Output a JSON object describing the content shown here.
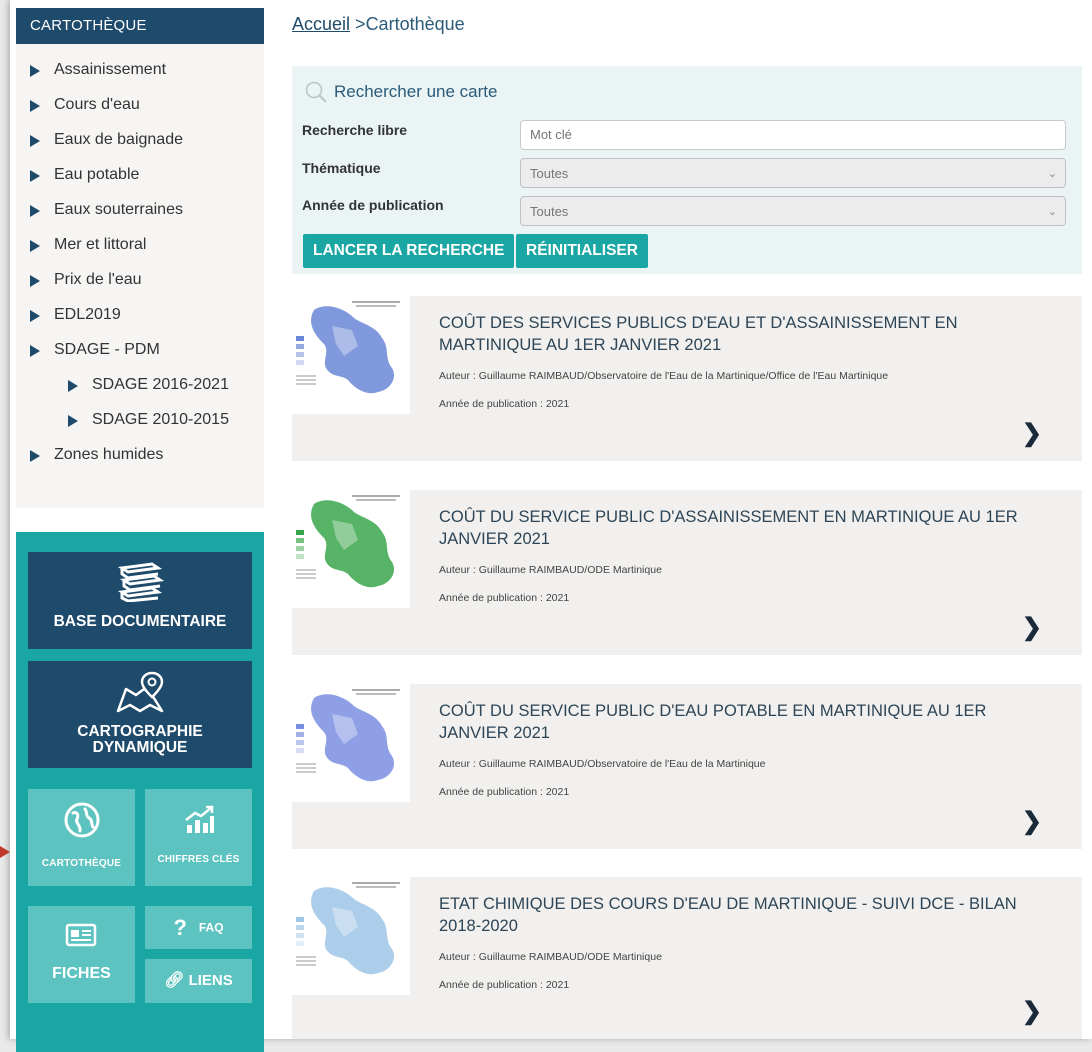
{
  "sidebar": {
    "title": "CARTOTHÈQUE",
    "items": [
      {
        "label": "Assainissement"
      },
      {
        "label": "Cours d'eau"
      },
      {
        "label": "Eaux de baignade"
      },
      {
        "label": "Eau potable"
      },
      {
        "label": "Eaux souterraines"
      },
      {
        "label": "Mer et littoral"
      },
      {
        "label": "Prix de l'eau"
      },
      {
        "label": "EDL2019"
      },
      {
        "label": "SDAGE - PDM"
      },
      {
        "label": "SDAGE 2016-2021"
      },
      {
        "label": "SDAGE 2010-2015"
      },
      {
        "label": "Zones humides"
      }
    ],
    "tiles": {
      "base_documentaire": "BASE DOCUMENTAIRE",
      "cartographie_line1": "CARTOGRAPHIE",
      "cartographie_line2": "DYNAMIQUE",
      "cartotheque": "CARTOTHÈQUE",
      "chiffres_cles": "CHIFFRES CLÉS",
      "fiches": "FICHES",
      "faq": "FAQ",
      "liens": "LIENS"
    }
  },
  "breadcrumb": {
    "home": "Accueil",
    "separator": ">",
    "current": "Cartothèque"
  },
  "search": {
    "title": "Rechercher une carte",
    "free_label": "Recherche libre",
    "free_placeholder": "Mot clé",
    "theme_label": "Thématique",
    "theme_value": "Toutes",
    "year_label": "Année de publication",
    "year_value": "Toutes",
    "submit_label": "LANCER LA RECHERCHE",
    "reset_label": "RÉINITIALISER"
  },
  "results": [
    {
      "title": "COÛT DES SERVICES PUBLICS D'EAU ET D'ASSAINISSEMENT EN MARTINIQUE AU 1ER JANVIER 2021",
      "author": "Auteur : Guillaume RAIMBAUD/Observatoire de l'Eau de la Martinique/Office de l'Eau Martinique",
      "year": "Année de publication : 2021",
      "map_color": "#6a86d6"
    },
    {
      "title": "COÛT DU SERVICE PUBLIC D'ASSAINISSEMENT EN MARTINIQUE AU 1ER JANVIER 2021",
      "author": "Auteur : Guillaume RAIMBAUD/ODE Martinique",
      "year": "Année de publication : 2021",
      "map_color": "#3aa64a"
    },
    {
      "title": "COÛT DU SERVICE PUBLIC D'EAU POTABLE EN MARTINIQUE AU 1ER JANVIER 2021",
      "author": "Auteur : Guillaume RAIMBAUD/Observatoire de l'Eau de la Martinique",
      "year": "Année de publication : 2021",
      "map_color": "#7a8ee0"
    },
    {
      "title": "ETAT CHIMIQUE DES COURS D'EAU DE MARTINIQUE - SUIVI DCE - BILAN 2018-2020",
      "author": "Auteur : Guillaume RAIMBAUD/ODE Martinique",
      "year": "Année de publication : 2021",
      "map_color": "#9ec6e6"
    }
  ],
  "colors": {
    "navy": "#1e4a6b",
    "teal": "#1aa6a3",
    "light_teal": "#5cc3c0"
  }
}
